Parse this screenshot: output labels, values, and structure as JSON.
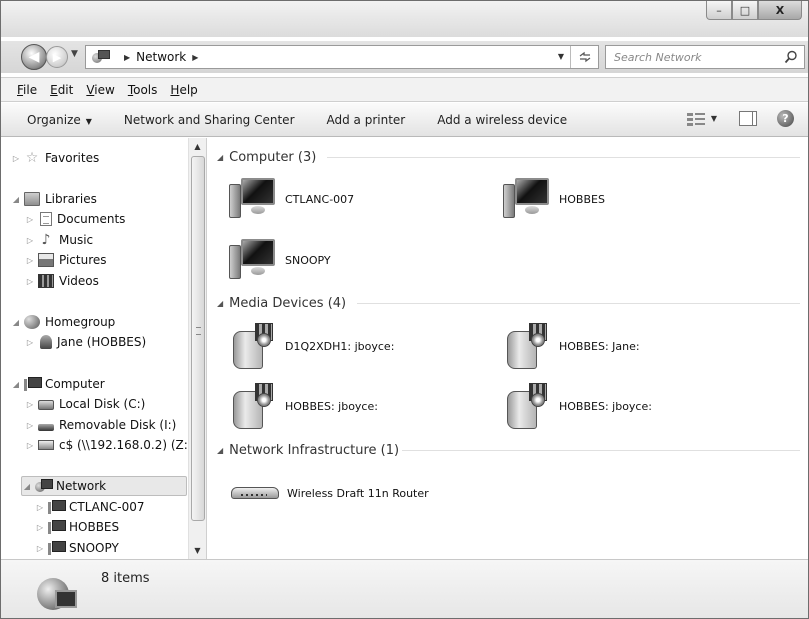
{
  "window": {
    "caption_buttons": [
      "–",
      "□",
      "X"
    ]
  },
  "address": {
    "crumbs": [
      "Network"
    ],
    "search_placeholder": "Search Network"
  },
  "menu": {
    "items": [
      {
        "underline": "F",
        "rest": "ile"
      },
      {
        "underline": "E",
        "rest": "dit"
      },
      {
        "underline": "V",
        "rest": "iew"
      },
      {
        "underline": "T",
        "rest": "ools"
      },
      {
        "underline": "H",
        "rest": "elp"
      }
    ]
  },
  "commands": {
    "organize": "Organize",
    "network_sharing": "Network and Sharing Center",
    "add_printer": "Add a printer",
    "add_wireless": "Add a wireless device"
  },
  "nav": {
    "favorites": "Favorites",
    "libraries": "Libraries",
    "documents": "Documents",
    "music": "Music",
    "pictures": "Pictures",
    "videos": "Videos",
    "homegroup": "Homegroup",
    "homegroup_user": "Jane (HOBBES)",
    "computer": "Computer",
    "local_disk": "Local Disk (C:)",
    "removable_disk": "Removable Disk (I:)",
    "network_drive": "c$ (\\\\192.168.0.2) (Z:)",
    "network": "Network",
    "net_pc_1": "CTLANC-007",
    "net_pc_2": "HOBBES",
    "net_pc_3": "SNOOPY"
  },
  "groups": {
    "computer": {
      "title": "Computer (3)",
      "items": [
        "CTLANC-007",
        "HOBBES",
        "SNOOPY"
      ]
    },
    "media": {
      "title": "Media Devices (4)",
      "items": [
        "D1Q2XDH1: jboyce:",
        "HOBBES: Jane:",
        "HOBBES: jboyce:",
        "HOBBES: jboyce:"
      ]
    },
    "infrastructure": {
      "title": "Network Infrastructure (1)",
      "items": [
        "Wireless Draft 11n Router"
      ]
    }
  },
  "status": {
    "item_count": "8 items"
  },
  "icons": {
    "back": "back-arrow-icon",
    "forward": "forward-arrow-icon",
    "refresh": "refresh-icon",
    "search": "search-icon",
    "help": "help-icon"
  }
}
